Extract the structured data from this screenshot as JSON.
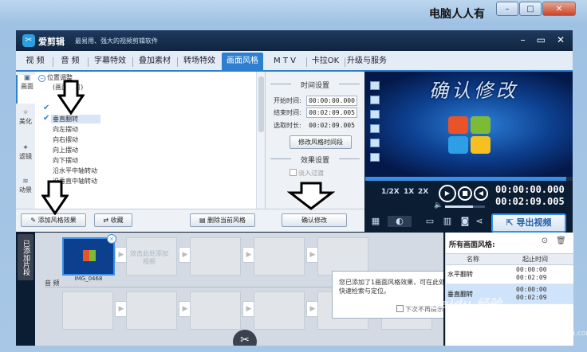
{
  "outer": {
    "watermark_text": "电脑人人有"
  },
  "app": {
    "name": "爱剪辑",
    "slogan": "最易用、强大的视频剪辑软件",
    "tabs": [
      "视 频",
      "音 频",
      "字幕特效",
      "叠加素材",
      "转场特效",
      "画面风格",
      "M T V",
      "卡拉OK",
      "升级与服务"
    ],
    "active_tab": "画面风格",
    "side_nav": [
      {
        "label": "画面",
        "icon": "picture-icon"
      },
      {
        "label": "美化",
        "icon": "wand-icon"
      },
      {
        "label": "滤镜",
        "icon": "filter-icon"
      },
      {
        "label": "动景",
        "icon": "wave-icon"
      }
    ]
  },
  "effect_list": {
    "category": "位置调整",
    "items": [
      {
        "label": "(画面裁剪)",
        "checked": false,
        "selected": false
      },
      {
        "label": "",
        "checked": true,
        "selected": false
      },
      {
        "label": "垂直翻转",
        "checked": true,
        "selected": true
      },
      {
        "label": "向左摆动",
        "checked": false,
        "selected": false
      },
      {
        "label": "向右摆动",
        "checked": false,
        "selected": false
      },
      {
        "label": "向上摆动",
        "checked": false,
        "selected": false
      },
      {
        "label": "向下摆动",
        "checked": false,
        "selected": false
      },
      {
        "label": "沿水平中轴转动",
        "checked": false,
        "selected": false
      },
      {
        "label": "沿垂直中轴转动",
        "checked": false,
        "selected": false
      }
    ]
  },
  "time_settings": {
    "title": "时间设置",
    "start_label": "开始时间:",
    "start_value": "00:00:00.000",
    "end_label": "结束时间:",
    "end_value": "00:02:09.005",
    "duration_label": "选取时长:",
    "duration_value": "00:02:09.005",
    "modify_button": "修改风格时间段",
    "effect_title": "效果设置",
    "fade_label": "淡入过渡"
  },
  "actions": {
    "add": "添加风格效果",
    "collect": "收藏",
    "delete": "删除当前风格",
    "confirm": "确认修改"
  },
  "preview": {
    "caption": "确认修改",
    "progress": 0.97,
    "speeds": [
      "1/2X",
      "1X",
      "2X"
    ],
    "current_time": "00:00:00.000",
    "total_time": "00:02:09.005",
    "volume": 0.7,
    "export_label": "导出视频"
  },
  "timeline": {
    "tab_label": "已添加片段",
    "clip_name": "IMG_0468",
    "placeholder": "双击此处添加视频",
    "audio_label": "音 频",
    "tooltip_text": "您已添加了1画面风格效果，可在此处快速检索与定位。",
    "tooltip_checkbox": "下次不再提示"
  },
  "style_panel": {
    "title": "所有画面风格:",
    "col_name": "名称",
    "col_time": "起止时间",
    "rows": [
      {
        "name": "水平翻转",
        "start": "00:00:00",
        "end": "00:02:09",
        "selected": false
      },
      {
        "name": "垂直翻转",
        "start": "00:00:00",
        "end": "00:02:09",
        "selected": true
      }
    ]
  },
  "watermarks": {
    "baidu": "Baidu 经验",
    "url": "jingyan.baidu.com"
  },
  "colors": {
    "accent": "#2d7fd0",
    "titlebar": "#10243d",
    "annotation": "#000000"
  }
}
